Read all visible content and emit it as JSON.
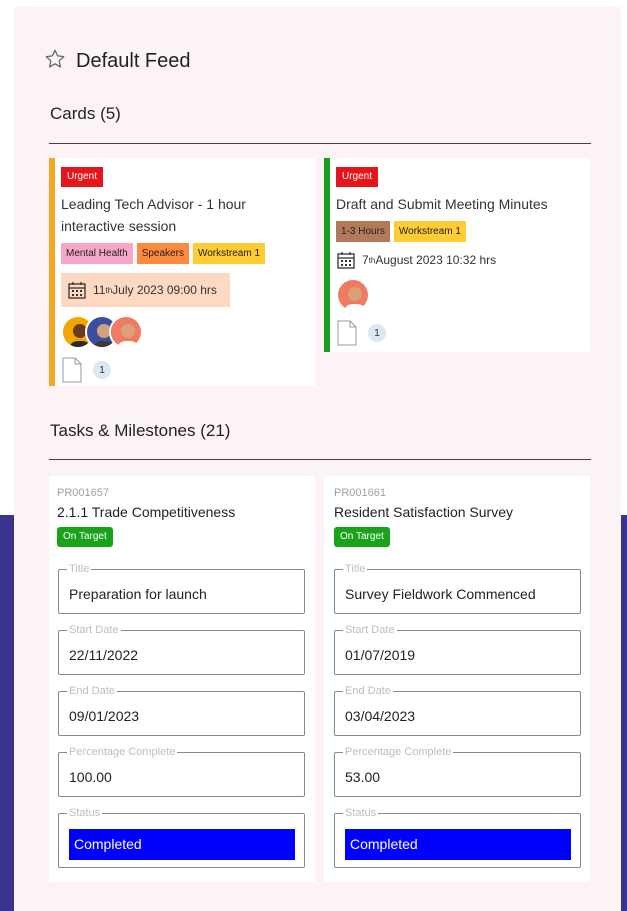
{
  "feed": {
    "title": "Default Feed",
    "star_icon": "star-outline-icon"
  },
  "cards_section": {
    "title": "Cards (5)",
    "cards": [
      {
        "accent_color": "#f5a623",
        "badge": "Urgent",
        "title": "Leading Tech Advisor - 1 hour interactive session",
        "tags": [
          {
            "label": "Mental Health",
            "color": "#f4a7c6"
          },
          {
            "label": "Speakers",
            "color": "#ff8a3d"
          },
          {
            "label": "Workstream 1",
            "color": "#ffcc33"
          }
        ],
        "date_day": "11",
        "date_suffix": "th",
        "date_rest": " July 2023 09:00 hrs",
        "attachment_count": "1"
      },
      {
        "accent_color": "#1a9e1a",
        "badge": "Urgent",
        "title": "Draft and Submit Meeting Minutes",
        "tags": [
          {
            "label": "1-3 Hours",
            "color": "#b27a5a"
          },
          {
            "label": "Workstream 1",
            "color": "#ffcc33"
          }
        ],
        "date_day": "7",
        "date_suffix": "th",
        "date_rest": " August 2023 10:32 hrs",
        "attachment_count": "1"
      }
    ]
  },
  "tasks_section": {
    "title": "Tasks & Milestones  (21)",
    "tasks": [
      {
        "code": "PR001657",
        "name": "2.1.1 Trade Competitiveness",
        "badge": "On Target",
        "fields": {
          "title_label": "Title",
          "title_value": "Preparation for launch",
          "start_label": "Start Date",
          "start_value": "22/11/2022",
          "end_label": "End Date",
          "end_value": "09/01/2023",
          "pct_label": "Percentage Complete",
          "pct_value": "100.00",
          "status_label": "Status",
          "status_value": "Completed"
        }
      },
      {
        "code": "PR001661",
        "name": "Resident Satisfaction Survey",
        "badge": "On Target",
        "fields": {
          "title_label": "Title",
          "title_value": "Survey Fieldwork Commenced",
          "start_label": "Start Date",
          "start_value": "01/07/2019",
          "end_label": "End Date",
          "end_value": "03/04/2023",
          "pct_label": "Percentage Complete",
          "pct_value": "53.00",
          "status_label": "Status",
          "status_value": "Completed"
        }
      }
    ]
  },
  "colors": {
    "background_accent": "#3a348f",
    "urgent": "#e4161b",
    "on_target": "#1aa31a",
    "status_completed": "#0000ff"
  }
}
